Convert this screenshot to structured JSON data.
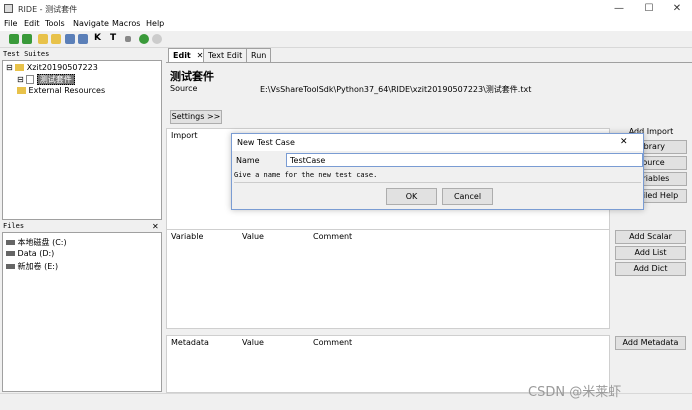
{
  "window": {
    "title": "RIDE - 测试套件",
    "minimize": "—",
    "maximize": "☐",
    "close": "✕"
  },
  "menu": [
    "File",
    "Edit",
    "Tools",
    "Navigate",
    "Macros",
    "Help"
  ],
  "toolbar": {
    "k_label": "K",
    "t_label": "T"
  },
  "left": {
    "suites_header": "Test Suites",
    "tree": {
      "root": "Xzit20190507223",
      "child": "测试套件",
      "external": "External Resources"
    },
    "files_header": "Files",
    "files_close": "✕",
    "drives": [
      "本地磁盘 (C:)",
      "Data (D:)",
      "新加卷 (E:)"
    ]
  },
  "tabs": [
    "Edit",
    "Text Edit",
    "Run"
  ],
  "tab_close": "✕",
  "editor": {
    "suite_title": "测试套件",
    "source_label": "Source",
    "source_path": "E:\\VsShareToolSdk\\Python37_64\\RIDE\\xzit20190507223\\测试套件.txt",
    "settings_button": "Settings >>",
    "import_label": "Import",
    "import_buttons": [
      "Add Import",
      "Library",
      "Source",
      "Variables",
      "Detailed Help"
    ],
    "variable_headers": [
      "Variable",
      "Value",
      "Comment"
    ],
    "variable_buttons": [
      "Add Scalar",
      "Add List",
      "Add Dict"
    ],
    "metadata_headers": [
      "Metadata",
      "Value",
      "Comment"
    ],
    "metadata_button": "Add Metadata"
  },
  "dialog": {
    "title": "New Test Case",
    "close": "✕",
    "name_label": "Name",
    "name_value": "TestCase",
    "hint": "Give a name for the new test case.",
    "ok": "OK",
    "cancel": "Cancel"
  },
  "watermark": "CSDN @米莱虾"
}
